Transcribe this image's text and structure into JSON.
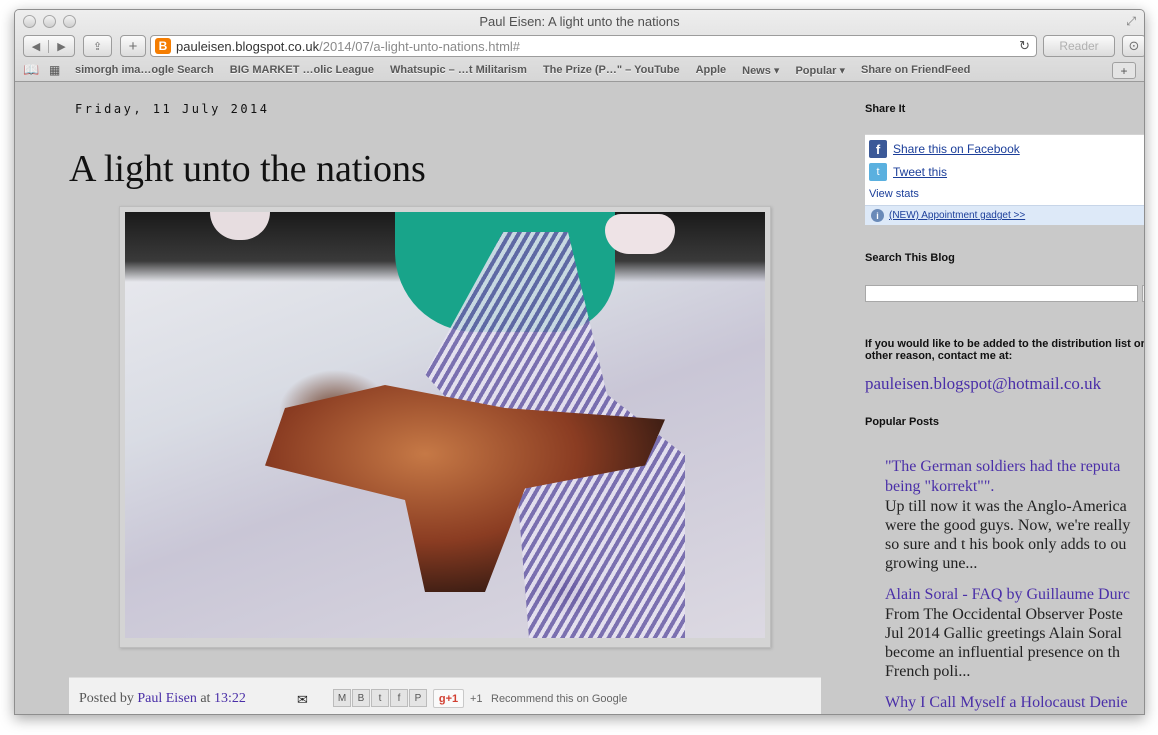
{
  "window": {
    "title": "Paul Eisen: A light unto the nations"
  },
  "toolbar": {
    "back_icon": "back-arrow-icon",
    "forward_icon": "forward-arrow-icon",
    "back_glyph": "◀",
    "forward_glyph": "▶",
    "share_glyph": "⇪",
    "addtab_glyph": "+",
    "url_domain": "pauleisen.blogspot.co.uk",
    "url_path": "/2014/07/a-light-unto-nations.html#",
    "favicon_glyph": "B",
    "reload_glyph": "↻",
    "reader_label": "Reader",
    "download_glyph": "⊙"
  },
  "bookmarks": {
    "items": [
      "simorgh ima…ogle Search",
      "BIG MARKET …olic League",
      "Whatsupic – …t Militarism",
      "The Prize (P…\" – YouTube",
      "Apple",
      "News ▾",
      "Popular ▾",
      "Share on FriendFeed"
    ],
    "book_glyph": "📖",
    "grid_glyph": "▦",
    "add_glyph": "+"
  },
  "post": {
    "date": "Friday, 11 July 2014",
    "title": "A light unto the nations",
    "posted_prefix": "Posted by",
    "author": "Paul Eisen",
    "at": "at",
    "time": "13:22",
    "share_icons": [
      "M",
      "B",
      "t",
      "f",
      "P"
    ],
    "gplus_label": "g+1",
    "plus_count": "+1",
    "recommend": "Recommend this on Google",
    "email_glyph": "✉"
  },
  "sidebar": {
    "share_heading": "Share It",
    "facebook_label": "Share this on Facebook",
    "tweet_label": "Tweet this",
    "view_stats": "View stats",
    "gadget_label": "(NEW) Appointment gadget >>",
    "search_heading": "Search This Blog",
    "contact_text_1": "If you would like to be added to the distribution list or",
    "contact_text_2": "other reason, contact me at:",
    "contact_email": "pauleisen.blogspot@hotmail.co.uk",
    "popular_heading": "Popular Posts",
    "popular_posts": [
      {
        "title_1": "\"The German soldiers had the reputa",
        "title_2": "being \"korrekt\"\".",
        "snippet": [
          "Up till now it was the Anglo-America",
          "were the good guys. Now, we're really",
          "so sure and t his book only adds to ou",
          "growing une..."
        ]
      },
      {
        "title_1": "Alain Soral - FAQ by Guillaume Durc",
        "snippet": [
          "From The Occidental Observer Poste",
          "Jul 2014 Gallic greetings Alain Soral",
          "become an influential presence on th",
          "French poli..."
        ]
      },
      {
        "title_1": "Why I Call Myself a Holocaust Denie"
      }
    ]
  },
  "colors": {
    "link_purple": "#4a2fa8",
    "page_bg": "#c9c9c9",
    "blogger_orange": "#f57d00",
    "facebook_blue": "#3b5998",
    "twitter_blue": "#5ab0df"
  }
}
